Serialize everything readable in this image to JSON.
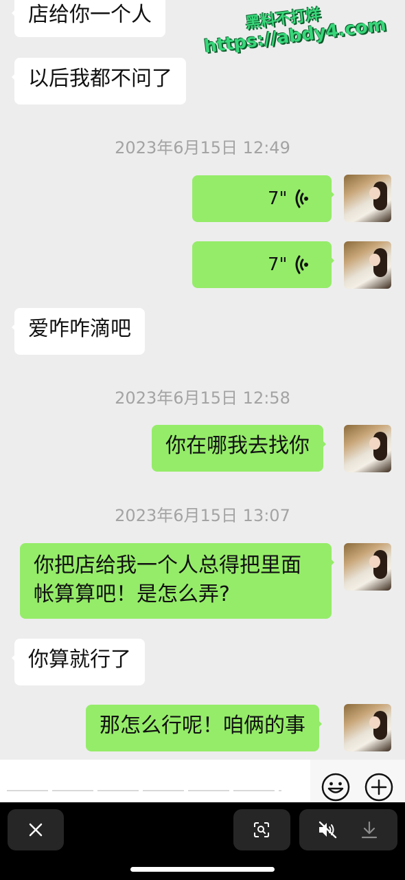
{
  "messages": [
    {
      "text": "店给你一个人"
    },
    {
      "text": "以后我都不问了"
    },
    {
      "text": "爱咋咋滴吧"
    },
    {
      "text": "你在哪我去找你"
    },
    {
      "line1": "你把店给我一个人总得把里面",
      "line2": "帐算算吧！是怎么弄?"
    },
    {
      "text": "你算就行了"
    },
    {
      "text": "那怎么行呢！咱俩的事"
    }
  ],
  "timestamps": [
    "2023年6月15日 12:49",
    "2023年6月15日 12:58",
    "2023年6月15日 13:07"
  ],
  "voice_messages": [
    {
      "duration": "7\""
    },
    {
      "duration": "7\""
    }
  ],
  "watermark": {
    "line1": "黑料不打烊",
    "line2": "https://abdy4.com"
  },
  "input": {
    "placeholder": ""
  },
  "icons": {
    "voice": "voice-wave-icon",
    "emoji": "emoji-icon",
    "add": "plus-icon",
    "close": "close-icon",
    "scan": "scan-icon",
    "mute": "mute-icon",
    "download": "download-icon"
  },
  "colors": {
    "sent_bubble": "#95ec69",
    "received_bubble": "#ffffff",
    "chat_background": "#ededed",
    "watermark": "#39d67a"
  }
}
